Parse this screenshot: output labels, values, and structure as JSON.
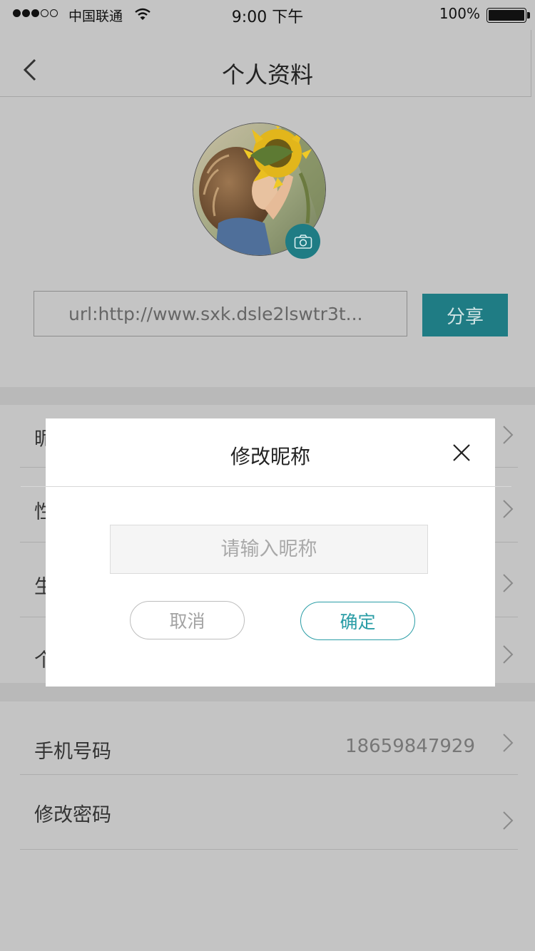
{
  "status_bar": {
    "carrier": "中国联通",
    "time": "9:00 下午",
    "battery": "100%",
    "signal_bars_filled": 3,
    "signal_bars_total": 5
  },
  "nav": {
    "title": "个人资料",
    "back_icon": "chevron-left-icon"
  },
  "profile": {
    "camera_icon": "camera-icon",
    "url_text": "url:http://www.sxk.dsle2lswtr3t...",
    "share_label": "分享"
  },
  "list_section_1": {
    "items": [
      {
        "label": "昵"
      },
      {
        "label": "性"
      },
      {
        "label": "生"
      },
      {
        "label": "个"
      }
    ]
  },
  "list_section_2": {
    "items": [
      {
        "label": "手机号码",
        "value": "18659847929"
      },
      {
        "label": "修改密码",
        "value": ""
      }
    ]
  },
  "dialog": {
    "title": "修改昵称",
    "close_icon": "close-icon",
    "input_placeholder": "请输入昵称",
    "input_value": "",
    "cancel_label": "取消",
    "confirm_label": "确定"
  },
  "colors": {
    "accent": "#1f7c84",
    "accent_light": "#2a9da6",
    "overlay_bg": "#c4c4c4",
    "dialog_bg": "#ffffff"
  }
}
